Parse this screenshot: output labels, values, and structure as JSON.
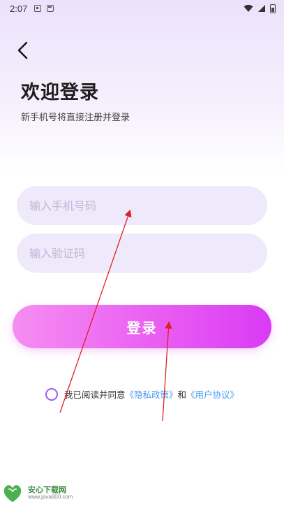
{
  "status_bar": {
    "time": "2:07"
  },
  "header": {
    "back_icon": "chevron-left-icon",
    "title": "欢迎登录",
    "subtitle": "新手机号将直接注册并登录"
  },
  "form": {
    "phone_placeholder": "输入手机号码",
    "code_placeholder": "输入验证码",
    "login_label": "登录"
  },
  "agreement": {
    "prefix": "我已阅读并同意",
    "privacy_link": "《隐私政策》",
    "conjunction": "和",
    "user_link": "《用户协议》",
    "checked": false
  },
  "watermark": {
    "title": "安心下载网",
    "url": "www.java800.com"
  },
  "colors": {
    "accent_start": "#f58ef1",
    "accent_end": "#d93bf5",
    "input_bg": "#efeafb",
    "link": "#4a9cf2",
    "annotation": "#e02020"
  }
}
